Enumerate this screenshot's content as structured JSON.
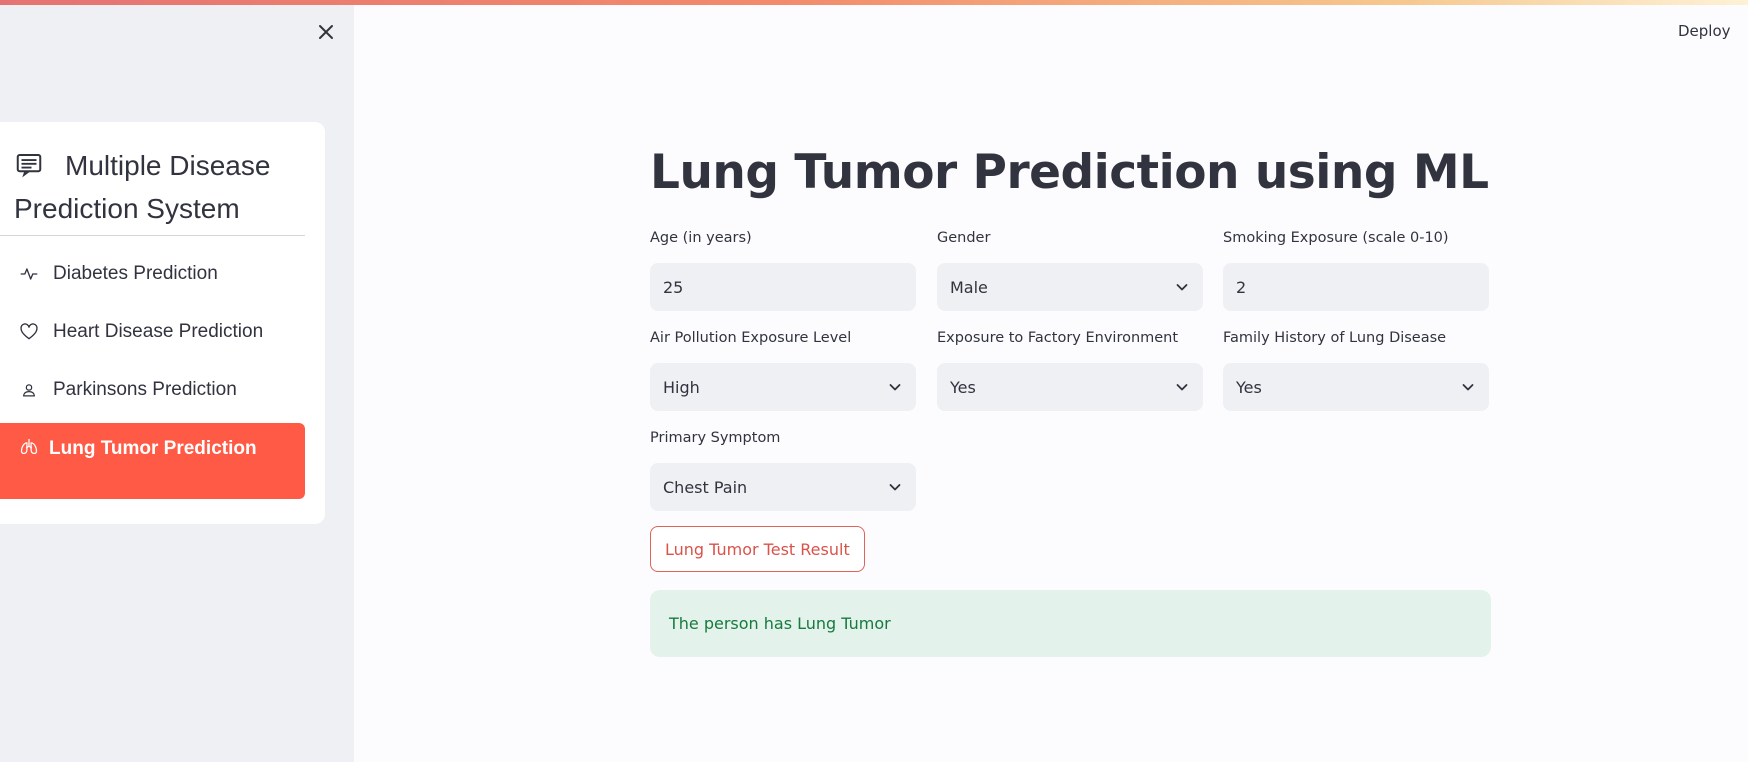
{
  "app": {
    "deploy_label": "Deploy",
    "accent_color": "#ff5a45"
  },
  "sidebar": {
    "title": "Multiple Disease Prediction System",
    "title_icon": "document-list-icon",
    "items": [
      {
        "label": "Diabetes Prediction",
        "icon": "activity-icon",
        "active": false
      },
      {
        "label": "Heart Disease Prediction",
        "icon": "heart-icon",
        "active": false
      },
      {
        "label": "Parkinsons Prediction",
        "icon": "person-icon",
        "active": false
      },
      {
        "label": "Lung Tumor Prediction",
        "icon": "lungs-icon",
        "active": true
      }
    ]
  },
  "main": {
    "title": "Lung Tumor Prediction using ML",
    "fields": {
      "age": {
        "label": "Age (in years)",
        "value": "25"
      },
      "gender": {
        "label": "Gender",
        "value": "Male"
      },
      "smoking": {
        "label": "Smoking Exposure (scale 0-10)",
        "value": "2"
      },
      "air_pollution": {
        "label": "Air Pollution Exposure Level",
        "value": "High"
      },
      "factory": {
        "label": "Exposure to Factory Environment",
        "value": "Yes"
      },
      "family_history": {
        "label": "Family History of Lung Disease",
        "value": "Yes"
      },
      "symptom": {
        "label": "Primary Symptom",
        "value": "Chest Pain"
      }
    },
    "submit_label": "Lung Tumor Test Result",
    "result_text": "The person has Lung Tumor"
  }
}
